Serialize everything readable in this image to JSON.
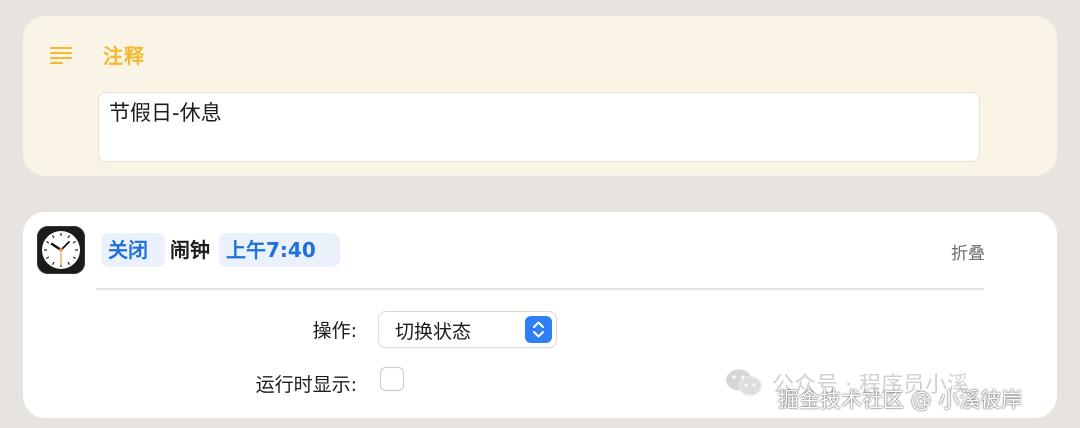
{
  "comment": {
    "title": "注释",
    "icon": "text-lines-icon",
    "text": "节假日-休息"
  },
  "action": {
    "app_icon": "clock-icon",
    "operation_token": "关闭",
    "name": "闹钟",
    "time_token": "上午7:40",
    "collapse_label": "折叠",
    "params": {
      "operation_label": "操作:",
      "operation_value": "切换状态",
      "show_when_run_label": "运行时显示:",
      "show_when_run_checked": false
    }
  },
  "watermark": {
    "line1": "公众号 · 程序员小溪",
    "line2": "掘金技术社区 @ 小溪彼岸"
  },
  "colors": {
    "comment_accent": "#f5b82e",
    "token_blue": "#1f6fdc",
    "stepper_blue": "#2f7ff6"
  }
}
